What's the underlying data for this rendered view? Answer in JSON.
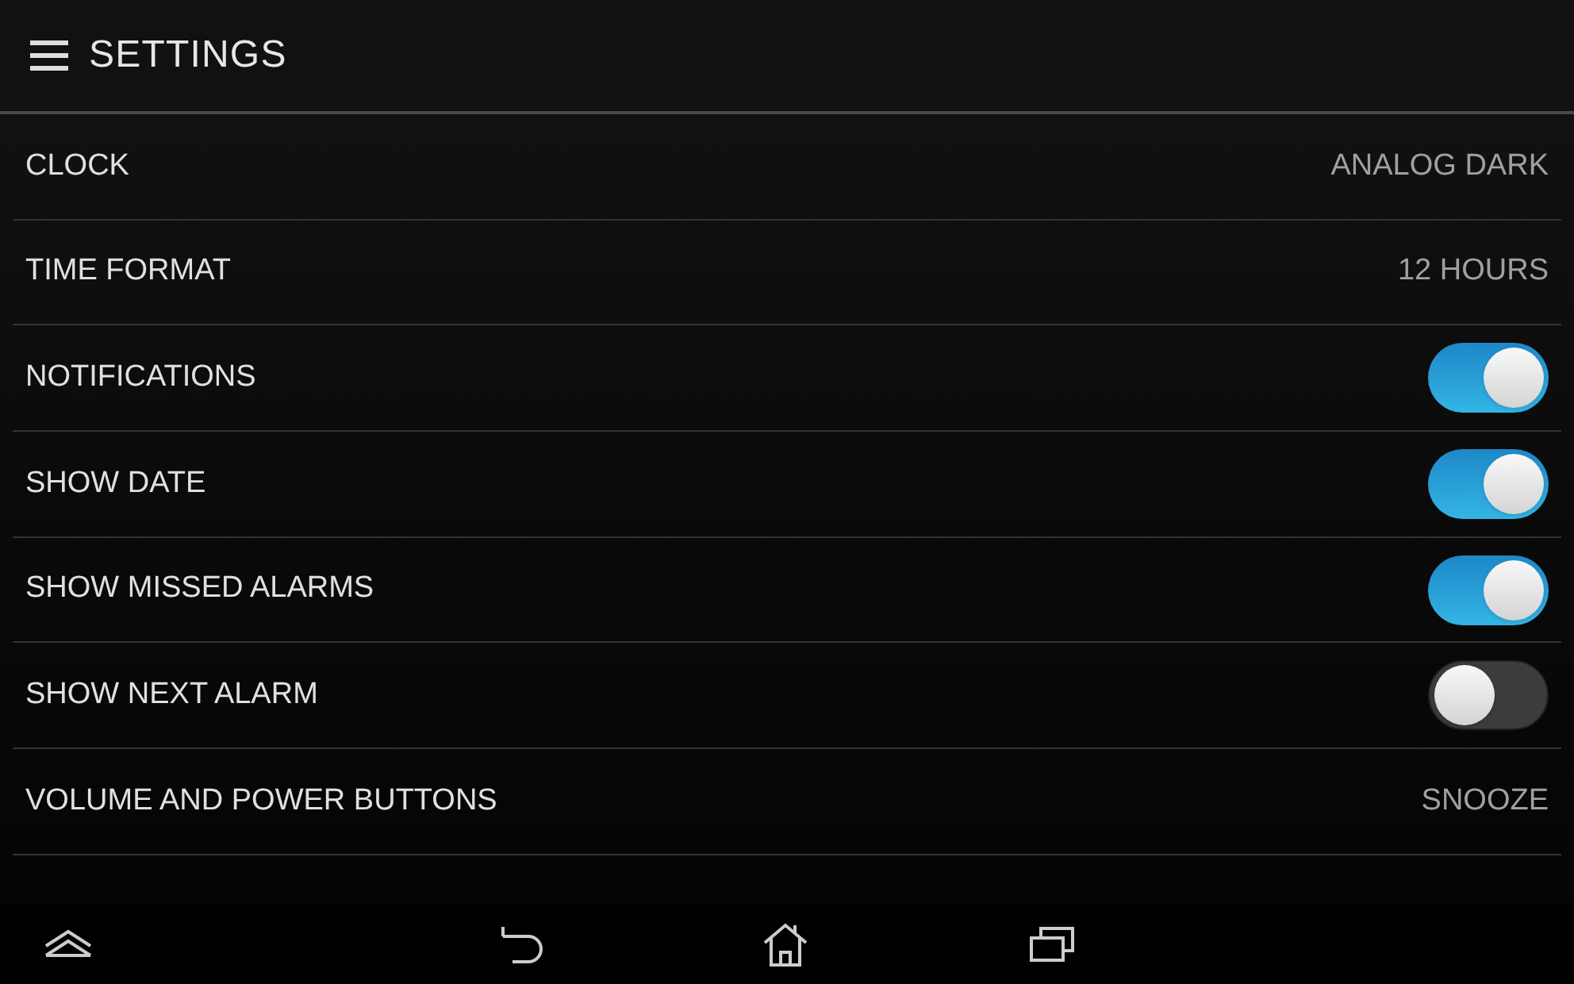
{
  "app_bar": {
    "title": "SETTINGS"
  },
  "settings": [
    {
      "kind": "value",
      "label": "CLOCK",
      "value": "ANALOG DARK"
    },
    {
      "kind": "value",
      "label": "TIME FORMAT",
      "value": "12 HOURS"
    },
    {
      "kind": "toggle",
      "label": "NOTIFICATIONS",
      "on": true
    },
    {
      "kind": "toggle",
      "label": "SHOW DATE",
      "on": true
    },
    {
      "kind": "toggle",
      "label": "SHOW MISSED ALARMS",
      "on": true
    },
    {
      "kind": "toggle",
      "label": "SHOW NEXT ALARM",
      "on": false
    },
    {
      "kind": "value",
      "label": "VOLUME AND POWER BUTTONS",
      "value": "SNOOZE"
    }
  ]
}
